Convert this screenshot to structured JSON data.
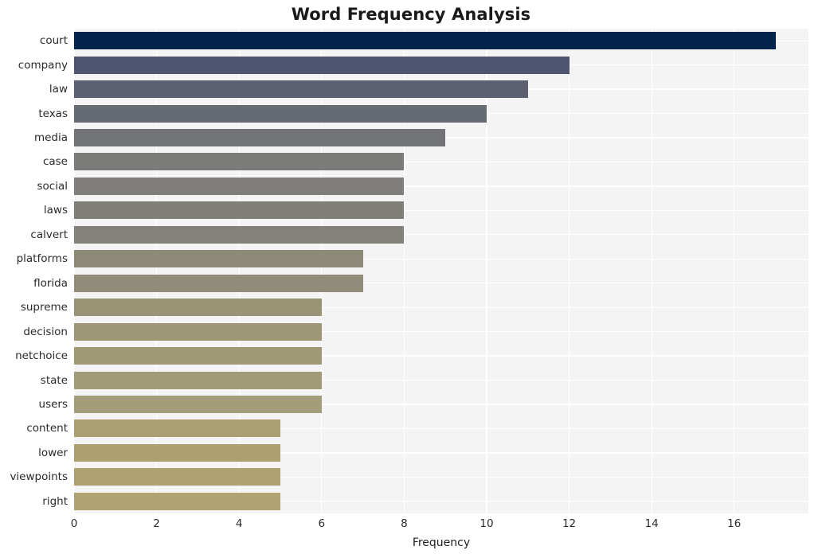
{
  "chart_data": {
    "type": "bar",
    "orientation": "horizontal",
    "title": "Word Frequency Analysis",
    "xlabel": "Frequency",
    "ylabel": "",
    "xlim": [
      0,
      17.8
    ],
    "xticks": [
      0,
      2,
      4,
      6,
      8,
      10,
      12,
      14,
      16
    ],
    "xtick_labels": [
      "0",
      "2",
      "4",
      "6",
      "8",
      "10",
      "12",
      "14",
      "16"
    ],
    "grid": true,
    "legend": null,
    "categories": [
      "court",
      "company",
      "law",
      "texas",
      "media",
      "case",
      "social",
      "laws",
      "calvert",
      "platforms",
      "florida",
      "supreme",
      "decision",
      "netchoice",
      "state",
      "users",
      "content",
      "lower",
      "viewpoints",
      "right"
    ],
    "values": [
      17,
      12,
      11,
      10,
      9,
      8,
      8,
      8,
      8,
      7,
      7,
      6,
      6,
      6,
      6,
      6,
      5,
      5,
      5,
      5
    ],
    "bar_colors": [
      "#04234d",
      "#4f5470",
      "#5c6070",
      "#666a72",
      "#727376",
      "#7b7b79",
      "#7f7e7b",
      "#817f7a",
      "#84817b",
      "#8d8a78",
      "#908c79",
      "#9a9477",
      "#9d9778",
      "#9f9978",
      "#a29b78",
      "#a49d79",
      "#ab9f71",
      "#ad9f6f",
      "#afa171",
      "#b0a272"
    ],
    "plot_bgcolor": "#f4f4f5",
    "grid_color": "#ffffff",
    "figure_bgcolor": "#ffffff"
  }
}
